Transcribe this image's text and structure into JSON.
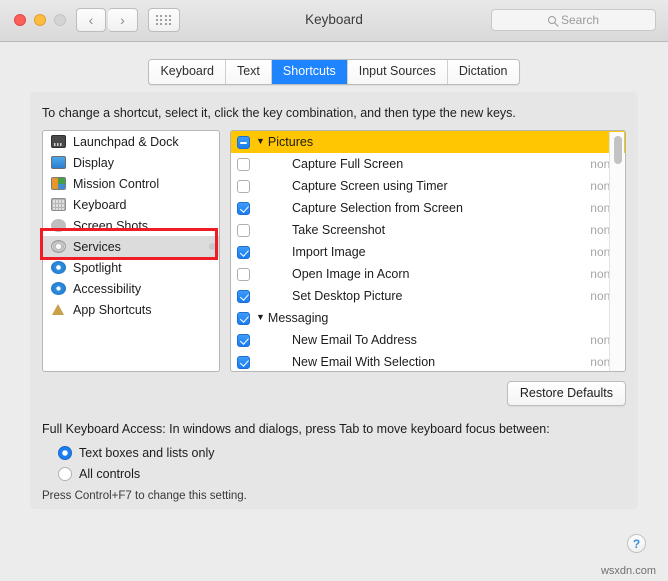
{
  "window": {
    "title": "Keyboard",
    "traffic_lights": [
      "close",
      "minimize",
      "zoom"
    ],
    "nav_back": "‹",
    "nav_forward": "›",
    "grid_icon": "grid-icon"
  },
  "search": {
    "placeholder": "Search",
    "value": "",
    "icon": "search-icon"
  },
  "tabs": [
    {
      "label": "Keyboard",
      "active": false
    },
    {
      "label": "Text",
      "active": false
    },
    {
      "label": "Shortcuts",
      "active": true
    },
    {
      "label": "Input Sources",
      "active": false
    },
    {
      "label": "Dictation",
      "active": false
    }
  ],
  "hint": "To change a shortcut, select it, click the key combination, and then type the new keys.",
  "sidebar": {
    "items": [
      {
        "label": "Launchpad & Dock",
        "icon": "launchpad-dock-icon",
        "selected": false
      },
      {
        "label": "Display",
        "icon": "display-icon",
        "selected": false
      },
      {
        "label": "Mission Control",
        "icon": "mission-control-icon",
        "selected": false
      },
      {
        "label": "Keyboard",
        "icon": "keyboard-icon",
        "selected": false
      },
      {
        "label": "Screen Shots",
        "icon": "screen-shots-icon",
        "selected": false
      },
      {
        "label": "Services",
        "icon": "services-gear-icon",
        "selected": true
      },
      {
        "label": "Spotlight",
        "icon": "spotlight-icon",
        "selected": false
      },
      {
        "label": "Accessibility",
        "icon": "accessibility-icon",
        "selected": false
      },
      {
        "label": "App Shortcuts",
        "icon": "app-shortcuts-icon",
        "selected": false
      }
    ]
  },
  "shortcut_list": {
    "rows": [
      {
        "label": "Pictures",
        "type": "group",
        "checkbox": "mixed",
        "shortcut": "",
        "highlighted": true
      },
      {
        "label": "Capture Full Screen",
        "type": "child",
        "checkbox": "unchecked",
        "shortcut": "none",
        "highlighted": false
      },
      {
        "label": "Capture Screen using Timer",
        "type": "child",
        "checkbox": "unchecked",
        "shortcut": "none",
        "highlighted": false
      },
      {
        "label": "Capture Selection from Screen",
        "type": "child",
        "checkbox": "checked",
        "shortcut": "none",
        "highlighted": false
      },
      {
        "label": "Take Screenshot",
        "type": "child",
        "checkbox": "unchecked",
        "shortcut": "none",
        "highlighted": false
      },
      {
        "label": "Import Image",
        "type": "child",
        "checkbox": "checked",
        "shortcut": "none",
        "highlighted": false
      },
      {
        "label": "Open Image in Acorn",
        "type": "child",
        "checkbox": "unchecked",
        "shortcut": "none",
        "highlighted": false
      },
      {
        "label": "Set Desktop Picture",
        "type": "child",
        "checkbox": "checked",
        "shortcut": "none",
        "highlighted": false
      },
      {
        "label": "Messaging",
        "type": "group",
        "checkbox": "checked",
        "shortcut": "",
        "highlighted": false
      },
      {
        "label": "New Email To Address",
        "type": "child",
        "checkbox": "checked",
        "shortcut": "none",
        "highlighted": false
      },
      {
        "label": "New Email With Selection",
        "type": "child",
        "checkbox": "checked",
        "shortcut": "none",
        "highlighted": false
      }
    ]
  },
  "buttons": {
    "restore_defaults": "Restore Defaults",
    "help": "?"
  },
  "full_keyboard_access": {
    "label": "Full Keyboard Access: In windows and dialogs, press Tab to move keyboard focus between:",
    "options": [
      {
        "label": "Text boxes and lists only",
        "selected": true
      },
      {
        "label": "All controls",
        "selected": false
      }
    ],
    "note": "Press Control+F7 to change this setting."
  },
  "annotation": {
    "color": "#ee1c25",
    "target": "Services"
  },
  "watermark": "wsxdn.com"
}
